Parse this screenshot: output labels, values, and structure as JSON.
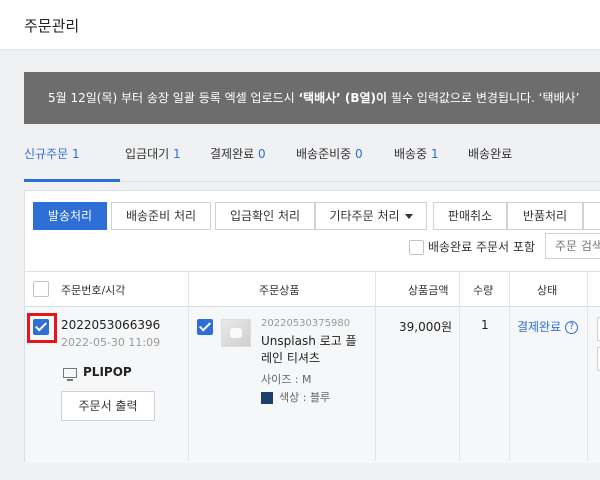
{
  "header": {
    "title": "주문관리"
  },
  "notice": {
    "text_before": "5월 12일(목) 부터 송장 일괄 등록 엑셀 업로드시 ",
    "text_bold": "‘택배사’ (B열)이",
    "text_after": " 필수 입력값으로 변경됩니다. ‘택배사’"
  },
  "tabs": [
    {
      "label": "신규주문",
      "count": "1"
    },
    {
      "label": "입금대기",
      "count": "1"
    },
    {
      "label": "결제완료",
      "count": "0"
    },
    {
      "label": "배송준비중",
      "count": "0"
    },
    {
      "label": "배송중",
      "count": "1"
    },
    {
      "label": "배송완료",
      "count": ""
    }
  ],
  "toolbar": {
    "ship_process": "발송처리",
    "prepare_process": "배송준비 처리",
    "deposit_confirm": "입금확인 처리",
    "other_order": "기타주문 처리",
    "cancel_sale": "판매취소",
    "return_process": "반품처리",
    "include_delivered": "배송완료 주문서 포함",
    "search_placeholder": "주문 검색"
  },
  "table": {
    "headers": [
      "주문번호/시각",
      "주문상품",
      "상품금액",
      "수량",
      "상태"
    ]
  },
  "order": {
    "number": "2022053066396",
    "datetime": "2022-05-30 11:09",
    "platform": "PLIPOP",
    "print_label": "주문서 출력",
    "product_id": "20220530375980",
    "product_name": "Unsplash 로고 플레인 티셔츠",
    "size": "사이즈 : M",
    "color": "색상 : 블루",
    "price": "39,000원",
    "quantity": "1",
    "status": "결제완료",
    "status_help": "?",
    "checked": true
  },
  "colors": {
    "accent": "#2d6fd6",
    "highlight": "#e8141c",
    "notice_bg": "#6d6d6d"
  }
}
